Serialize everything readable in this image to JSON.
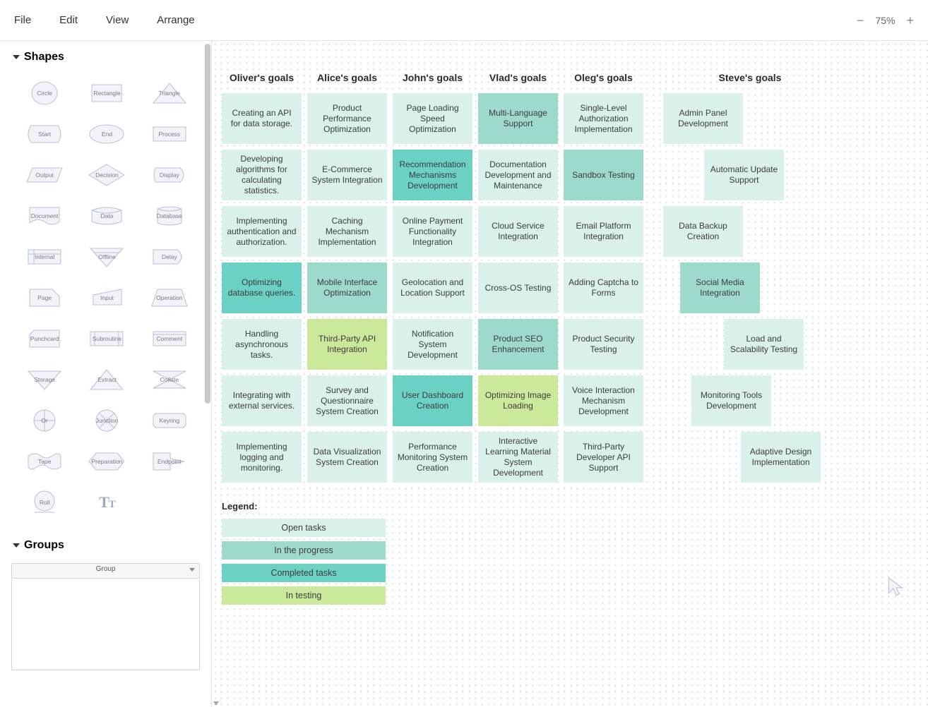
{
  "menu": {
    "file": "File",
    "edit": "Edit",
    "view": "View",
    "arrange": "Arrange"
  },
  "zoom": {
    "value": "75%"
  },
  "sidebar": {
    "shapes_header": "Shapes",
    "groups_header": "Groups",
    "group_select": "Group",
    "shapes": [
      "Circle",
      "Rectangle",
      "Triangle",
      "Start",
      "End",
      "Process",
      "Output",
      "Decision",
      "Display",
      "Document",
      "Data",
      "Database",
      "Internal",
      "Offline",
      "Delay",
      "Page",
      "Input",
      "Operation",
      "Punchcard",
      "Subroutine",
      "Comment",
      "Storage",
      "Extract",
      "Collate",
      "Or",
      "Junction",
      "Keyring",
      "Tape",
      "Preparation",
      "Endpoint",
      "Roll"
    ]
  },
  "columns": [
    {
      "title": "Oliver's goals",
      "cards": [
        {
          "t": "Creating an API for data storage.",
          "s": "open"
        },
        {
          "t": "Developing algorithms for calculating statistics.",
          "s": "open"
        },
        {
          "t": "Implementing authentication and authorization.",
          "s": "open"
        },
        {
          "t": "Optimizing database queries.",
          "s": "completed"
        },
        {
          "t": "Handling asynchronous tasks.",
          "s": "open"
        },
        {
          "t": "Integrating with external services.",
          "s": "open"
        },
        {
          "t": "Implementing logging and monitoring.",
          "s": "open"
        }
      ]
    },
    {
      "title": "Alice's goals",
      "cards": [
        {
          "t": "Product Performance Optimization",
          "s": "open"
        },
        {
          "t": "E-Commerce System Integration",
          "s": "open"
        },
        {
          "t": "Caching Mechanism Implementation",
          "s": "open"
        },
        {
          "t": "Mobile Interface Optimization",
          "s": "progress"
        },
        {
          "t": "Third-Party API Integration",
          "s": "testing"
        },
        {
          "t": "Survey and Questionnaire System Creation",
          "s": "open"
        },
        {
          "t": "Data Visualization System Creation",
          "s": "open"
        }
      ]
    },
    {
      "title": "John's goals",
      "cards": [
        {
          "t": "Page Loading Speed Optimization",
          "s": "open"
        },
        {
          "t": "Recommendation Mechanisms Development",
          "s": "completed"
        },
        {
          "t": "Online Payment Functionality Integration",
          "s": "open"
        },
        {
          "t": "Geolocation and Location Support",
          "s": "open"
        },
        {
          "t": "Notification System Development",
          "s": "open"
        },
        {
          "t": "User Dashboard Creation",
          "s": "completed"
        },
        {
          "t": "Performance Monitoring System Creation",
          "s": "open"
        }
      ]
    },
    {
      "title": "Vlad's goals",
      "cards": [
        {
          "t": "Multi-Language Support",
          "s": "progress"
        },
        {
          "t": "Documentation Development and Maintenance",
          "s": "open"
        },
        {
          "t": "Cloud Service Integration",
          "s": "open"
        },
        {
          "t": "Cross-OS Testing",
          "s": "open"
        },
        {
          "t": "Product SEO Enhancement",
          "s": "progress"
        },
        {
          "t": "Optimizing Image Loading",
          "s": "testing"
        },
        {
          "t": "Interactive Learning Material System Development",
          "s": "open"
        }
      ]
    },
    {
      "title": "Oleg's goals",
      "cards": [
        {
          "t": "Single-Level Authorization Implementation",
          "s": "open"
        },
        {
          "t": "Sandbox Testing",
          "s": "progress"
        },
        {
          "t": "Email Platform Integration",
          "s": "open"
        },
        {
          "t": "Adding Captcha to Forms",
          "s": "open"
        },
        {
          "t": "Product Security Testing",
          "s": "open"
        },
        {
          "t": "Voice Interaction Mechanism Development",
          "s": "open"
        },
        {
          "t": "Third-Party Developer API Support",
          "s": "open"
        }
      ]
    }
  ],
  "steve": {
    "title": "Steve's goals",
    "cards": [
      {
        "t": "Admin Panel Development",
        "s": "open",
        "off": 0
      },
      {
        "t": "Automatic Update Support",
        "s": "open",
        "off": 1
      },
      {
        "t": "Data Backup Creation",
        "s": "open",
        "off": 0
      },
      {
        "t": "Social Media Integration",
        "s": "progress",
        "off": 2
      },
      {
        "t": "Load and Scalability Testing",
        "s": "open",
        "off": 3
      },
      {
        "t": "Monitoring Tools Development",
        "s": "open",
        "off": 4
      },
      {
        "t": "Adaptive Design Implementation",
        "s": "open",
        "off": 5
      }
    ]
  },
  "legend": {
    "title": "Legend:",
    "rows": [
      {
        "t": "Open tasks",
        "s": "open"
      },
      {
        "t": "In the progress",
        "s": "progress"
      },
      {
        "t": "Completed tasks",
        "s": "completed"
      },
      {
        "t": "In testing",
        "s": "testing"
      }
    ]
  }
}
